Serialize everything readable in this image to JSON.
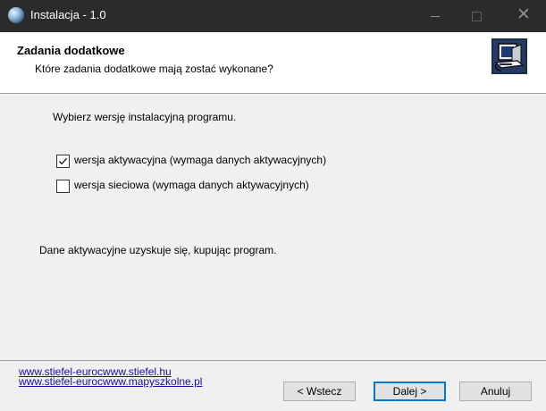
{
  "window": {
    "title": "Instalacja - 1.0",
    "icons": {
      "app": "globe-icon",
      "minimize": "minimize-icon",
      "maximize": "maximize-icon",
      "close": "close-icon"
    }
  },
  "header": {
    "title": "Zadania dodatkowe",
    "subtitle": "Które zadania dodatkowe mają zostać wykonane?",
    "icon": "installer-computer-icon"
  },
  "content": {
    "intro": "Wybierz wersję instalacyjną programu.",
    "options": [
      {
        "label": "wersja aktywacyjna (wymaga danych aktywacyjnych)",
        "checked": true
      },
      {
        "label": "wersja sieciowa (wymaga danych aktywacyjnych)",
        "checked": false
      }
    ],
    "note": "Dane aktywacyjne uzyskuje się, kupując program."
  },
  "footer": {
    "links": [
      "www.stiefel-eurocwww.stiefel.hu",
      "www.stiefel-eurocwww.mapyszkolne.pl"
    ],
    "back_label": "< Wstecz",
    "next_label": "Dalej >",
    "cancel_label": "Anuluj"
  },
  "colors": {
    "titlebar": "#2b2b2b",
    "header_bg": "#ffffff",
    "dialog_bg": "#f0f0f0",
    "link": "#1a0dab",
    "focus_border": "#0078d7"
  }
}
